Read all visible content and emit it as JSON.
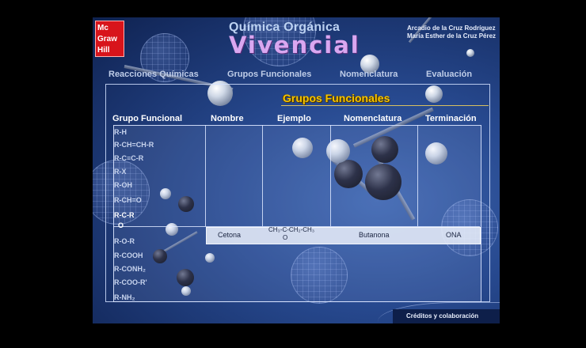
{
  "publisher_logo": [
    "Mc",
    "Graw",
    "Hill"
  ],
  "app_title_line1": "Química Orgánica",
  "app_title_line2": "Vivencial",
  "authors": [
    "Arcadio de la Cruz Rodríguez",
    "María Esther de la Cruz Pérez"
  ],
  "nav": [
    "Reacciones Químicas",
    "Grupos Funcionales",
    "Nomenclatura",
    "Evaluación"
  ],
  "section_title": "Grupos Funcionales",
  "table_headers": [
    "Grupo Funcional",
    "Nombre",
    "Ejemplo",
    "Nomenclatura",
    "Terminación"
  ],
  "functional_groups": [
    "R-H",
    "R-CH=CH-R",
    "R-C≡C-R",
    "R-X",
    "R-OH",
    "R-CH=O",
    "R-C-R",
    "R-O-R",
    "R-COOH",
    "R-CONH₂",
    "R-COO-R'",
    "R-NH₂"
  ],
  "active_group_carbonyl": "O",
  "selected_row": {
    "nombre": "Cetona",
    "ejemplo_line1": "CH₃-C-CH₂-CH₃",
    "ejemplo_line2": "O",
    "nomenclatura": "Butanona",
    "terminacion": "ONA"
  },
  "credits_button": "Créditos y colaboración",
  "colors": {
    "background": "#27498f",
    "accent": "#f4c400",
    "title_purple": "#d9a7f0"
  }
}
